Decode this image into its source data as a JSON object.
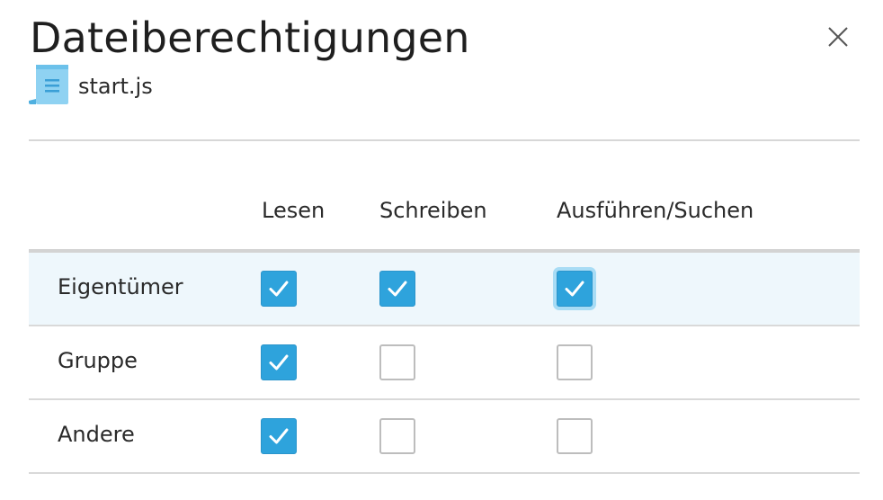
{
  "dialog": {
    "title": "Dateiberechtigungen",
    "close_icon": "close-icon",
    "file": {
      "icon": "script-file-icon",
      "name": "start.js"
    }
  },
  "permissions": {
    "columns": [
      "Lesen",
      "Schreiben",
      "Ausführen/Suchen"
    ],
    "rows": [
      {
        "label": "Eigentümer",
        "read": true,
        "write": true,
        "execute": true
      },
      {
        "label": "Gruppe",
        "read": true,
        "write": false,
        "execute": false
      },
      {
        "label": "Andere",
        "read": true,
        "write": false,
        "execute": false
      }
    ]
  },
  "colors": {
    "checkbox_checked": "#2ea3dc",
    "row_highlight": "#eef7fc",
    "focus_ring": "#a8dcf5"
  }
}
